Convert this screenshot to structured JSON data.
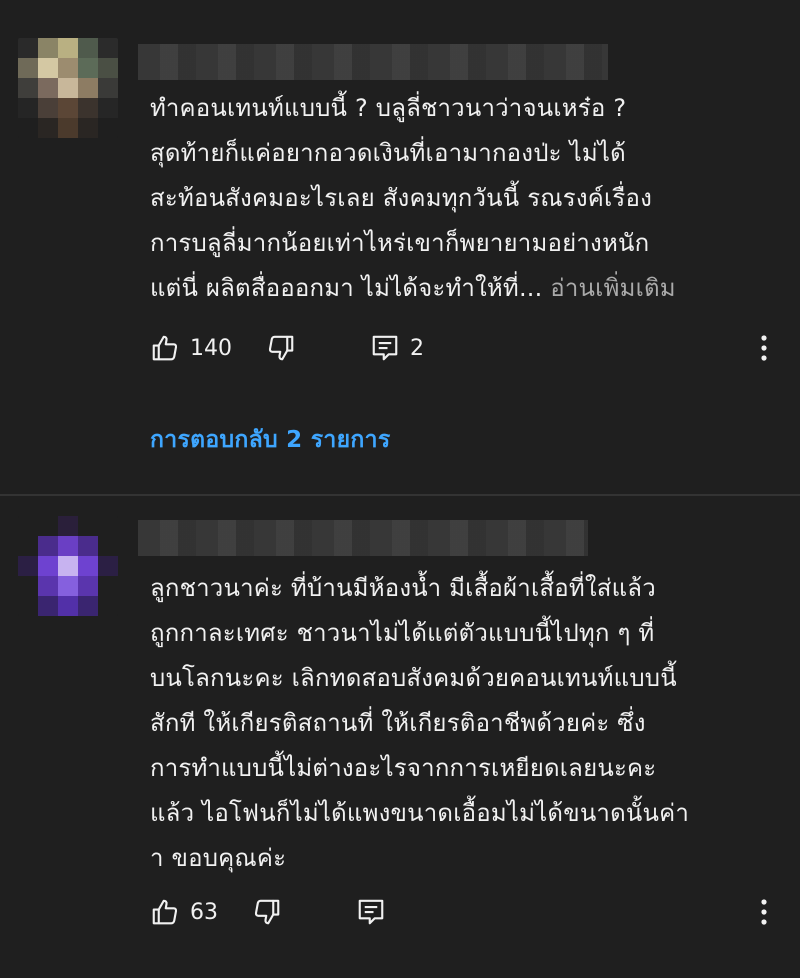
{
  "comments": [
    {
      "text": "ทำคอนเทนท์แบบนี้ ? บลูลี่ชาวนาว่าจนเหร๋อ ?\nสุดท้ายก็แค่อยากอวดเงินที่เอามากองป่ะ ไม่ได้\nสะท้อนสังคมอะไรเลย  สังคมทุกวันนี้ รณรงค์เรื่อง\nการบลูลี่มากน้อยเท่าไหร่เขาก็พยายามอย่างหนัก\nแต่นี่ ผลิตสื่อออกมา ไม่ได้จะทำให้ที่... ",
      "read_more": "อ่านเพิ่มเติม",
      "likes": "140",
      "replies": "2",
      "view_replies": "การตอบกลับ 2 รายการ"
    },
    {
      "text": "ลูกชาวนาค่ะ ที่บ้านมีห้องน้ำ มีเสื้อผ้าเสื้อที่ใส่แล้ว\nถูกกาละเทศะ ชาวนาไม่ได้แต่ตัวแบบนี้ไปทุก ๆ ที่\nบนโลกนะคะ เลิกทดสอบสังคมด้วยคอนเทนท์แบบนี้\nสักที ให้เกียรติสถานที่ ให้เกียรติอาชีพด้วยค่ะ ซึ่ง\nการทำแบบนี้ไม่ต่างอะไรจากการเหยียดเลยนะคะ\nแล้ว ไอโฟนก็ไม่ได้แพงขนาดเอื้อมไม่ได้ขนาดนั้นค่า\nา ขอบคุณค่ะ",
      "likes": "63"
    }
  ],
  "colors": {
    "background": "#1f1f1f",
    "text": "#f1f1f1",
    "link": "#3ea6ff",
    "muted": "#aaaaaa"
  },
  "icons": [
    "thumbs-up-icon",
    "thumbs-down-icon",
    "reply-icon",
    "more-vert-icon"
  ]
}
